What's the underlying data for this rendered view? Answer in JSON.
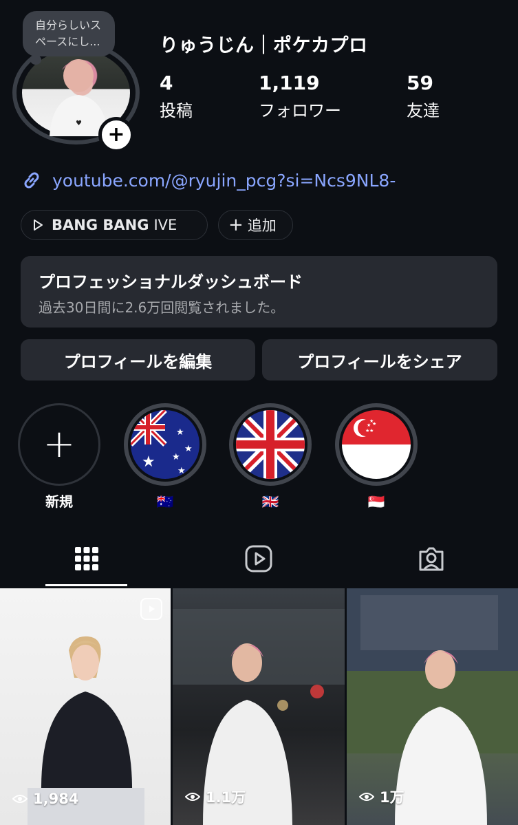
{
  "profile": {
    "note": "自分らしいスペースにし...",
    "note_line1": "自分らしいス",
    "note_line2": "ペースにし...",
    "username": "りゅうじん｜ポケカプロ",
    "stats": [
      {
        "value": "4",
        "label": "投稿"
      },
      {
        "value": "1,119",
        "label": "フォロワー"
      },
      {
        "value": "59",
        "label": "友達"
      }
    ],
    "link": "youtube.com/@ryujin_pcg?si=Ncs9NL8-"
  },
  "chips": {
    "music_song": "BANG BANG",
    "music_artist": "IVE",
    "add_label": "追加"
  },
  "dashboard": {
    "title": "プロフェッショナルダッシュボード",
    "subtitle": "過去30日間に2.6万回閲覧されました。"
  },
  "buttons": {
    "edit": "プロフィールを編集",
    "share": "プロフィールをシェア"
  },
  "highlights": [
    {
      "label": "新規",
      "icon": "plus-icon"
    },
    {
      "label": "🇦🇺",
      "icon": "australia-flag"
    },
    {
      "label": "🇬🇧",
      "icon": "uk-flag"
    },
    {
      "label": "🇸🇬",
      "icon": "singapore-flag"
    }
  ],
  "tabs": [
    {
      "icon": "grid-icon",
      "active": true
    },
    {
      "icon": "reels-icon",
      "active": false
    },
    {
      "icon": "tagged-icon",
      "active": false
    }
  ],
  "posts": [
    {
      "views": "1,984",
      "reel": true
    },
    {
      "views": "1.1万",
      "reel": false
    },
    {
      "views": "1万",
      "reel": false
    }
  ],
  "colors": {
    "background": "#0c0f14",
    "link": "#8aa6ff",
    "card": "#272a31"
  }
}
